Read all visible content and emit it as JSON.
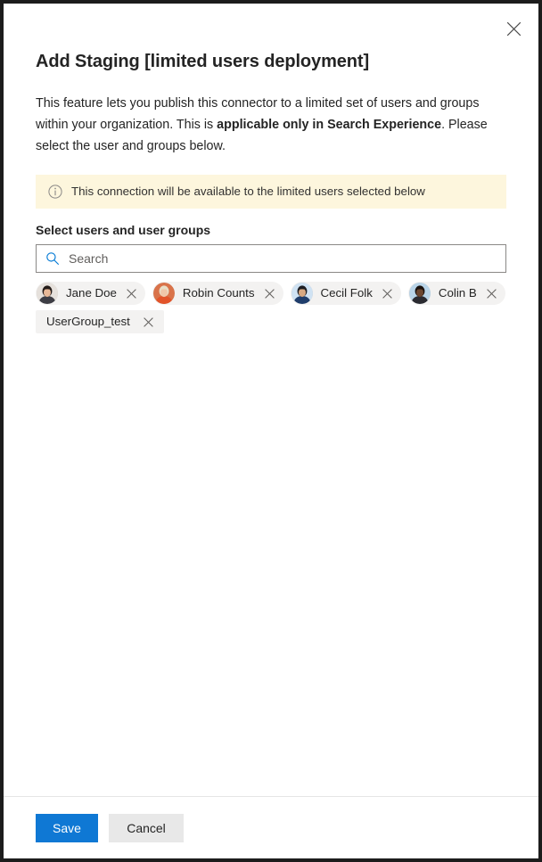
{
  "dialog": {
    "title": "Add Staging [limited users deployment]",
    "description_part1": "This feature lets you publish this connector to a limited set of users and groups within your organization. This is ",
    "description_bold": "applicable only in Search Experience",
    "description_part2": ". Please select the user and groups below.",
    "close_icon": "close-icon"
  },
  "info_bar": {
    "icon": "info-circle-icon",
    "text": "This connection will be available to the limited users selected below",
    "background_color": "#fdf6dd"
  },
  "picker": {
    "label": "Select users and user groups",
    "search": {
      "icon": "search-icon",
      "placeholder": "Search",
      "value": ""
    },
    "selected": [
      {
        "name": "Jane Doe",
        "type": "person",
        "avatar": "photo",
        "remove_icon": "close-icon",
        "avatar_colors": {
          "bg": "#e6e1dc",
          "hair": "#241c19",
          "skin": "#e8b897",
          "clothes": "#3d3d44"
        }
      },
      {
        "name": "Robin Counts",
        "type": "person",
        "avatar": "photo",
        "remove_icon": "close-icon",
        "avatar_colors": {
          "bg": "#d9734a",
          "hair": "#e8dfc8",
          "skin": "#f0c6a8",
          "clothes": "#e2542a"
        }
      },
      {
        "name": "Cecil Folk",
        "type": "person",
        "avatar": "photo",
        "remove_icon": "close-icon",
        "avatar_colors": {
          "bg": "#cfe2f3",
          "hair": "#1d1d22",
          "skin": "#d8a982",
          "clothes": "#1f3d6b"
        }
      },
      {
        "name": "Colin B",
        "type": "person",
        "avatar": "photo",
        "remove_icon": "close-icon",
        "avatar_colors": {
          "bg": "#b9d4e8",
          "hair": "#1a120e",
          "skin": "#6b4630",
          "clothes": "#2b2b31"
        }
      },
      {
        "name": "UserGroup_test",
        "type": "group",
        "avatar": "none",
        "remove_icon": "close-icon",
        "avatar_colors": null
      }
    ]
  },
  "footer": {
    "save_label": "Save",
    "cancel_label": "Cancel",
    "primary_color": "#0f78d4",
    "secondary_color": "#e8e8e8"
  }
}
